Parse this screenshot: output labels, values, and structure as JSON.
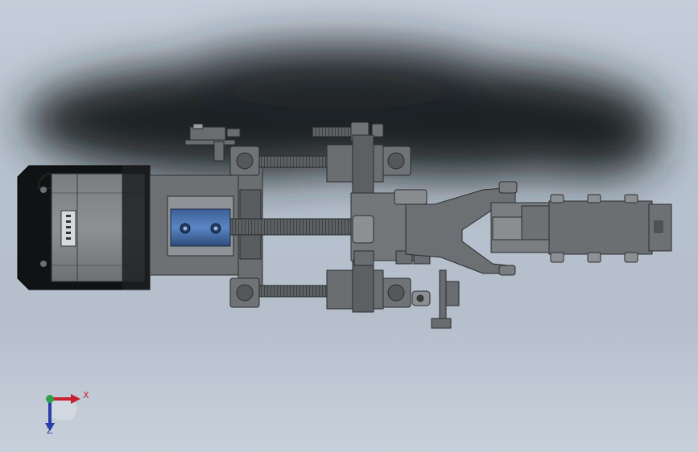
{
  "viewport": {
    "description_mode": "cad-model-view",
    "background_top": "#c4cdd9",
    "background_bottom": "#c8d0db"
  },
  "triad": {
    "x_label": "X",
    "z_label": "Z",
    "x_color": "#c8202c",
    "y_color": "#2fa04a",
    "z_color": "#2a3ea8"
  },
  "icons": {
    "triad": "axis-triad-icon"
  }
}
